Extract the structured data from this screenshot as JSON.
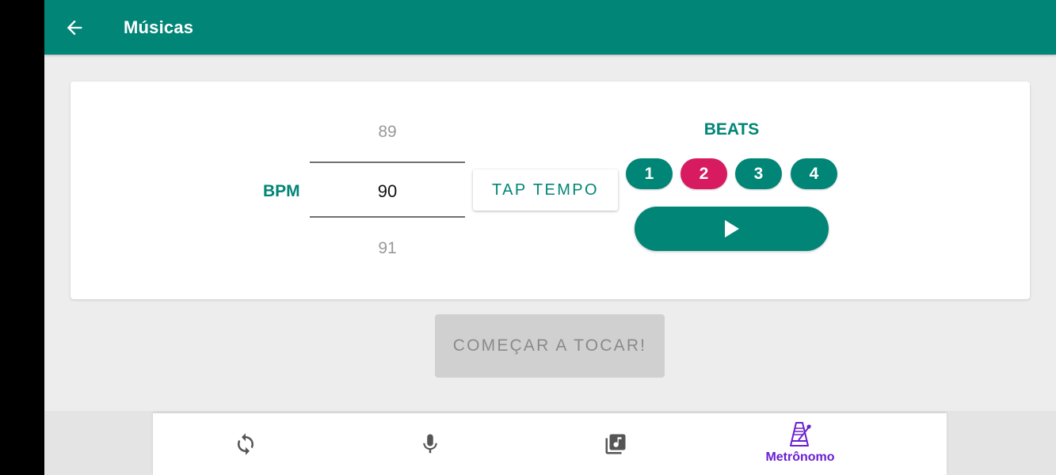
{
  "appbar": {
    "title": "Músicas",
    "back_icon": "arrow-left-icon",
    "color": "#018576"
  },
  "metronome": {
    "bpm_label": "BPM",
    "picker": {
      "previous": "89",
      "current": "90",
      "next": "91"
    },
    "tap_tempo_label": "TAP TEMPO",
    "beats_title": "BEATS",
    "beats": [
      {
        "label": "1",
        "active": false
      },
      {
        "label": "2",
        "active": true
      },
      {
        "label": "3",
        "active": false
      },
      {
        "label": "4",
        "active": false
      }
    ],
    "play_icon": "play-icon",
    "active_beat_color": "#d81b60"
  },
  "start_button": {
    "label": "COMEÇAR A TOCAR!",
    "enabled": false
  },
  "bottom_nav": {
    "items": [
      {
        "icon": "sync-icon",
        "label": ""
      },
      {
        "icon": "microphone-icon",
        "label": ""
      },
      {
        "icon": "music-library-icon",
        "label": ""
      },
      {
        "icon": "metronome-icon",
        "label": "Metrônomo",
        "selected": true
      }
    ],
    "selected_color": "#6a1fd0"
  }
}
